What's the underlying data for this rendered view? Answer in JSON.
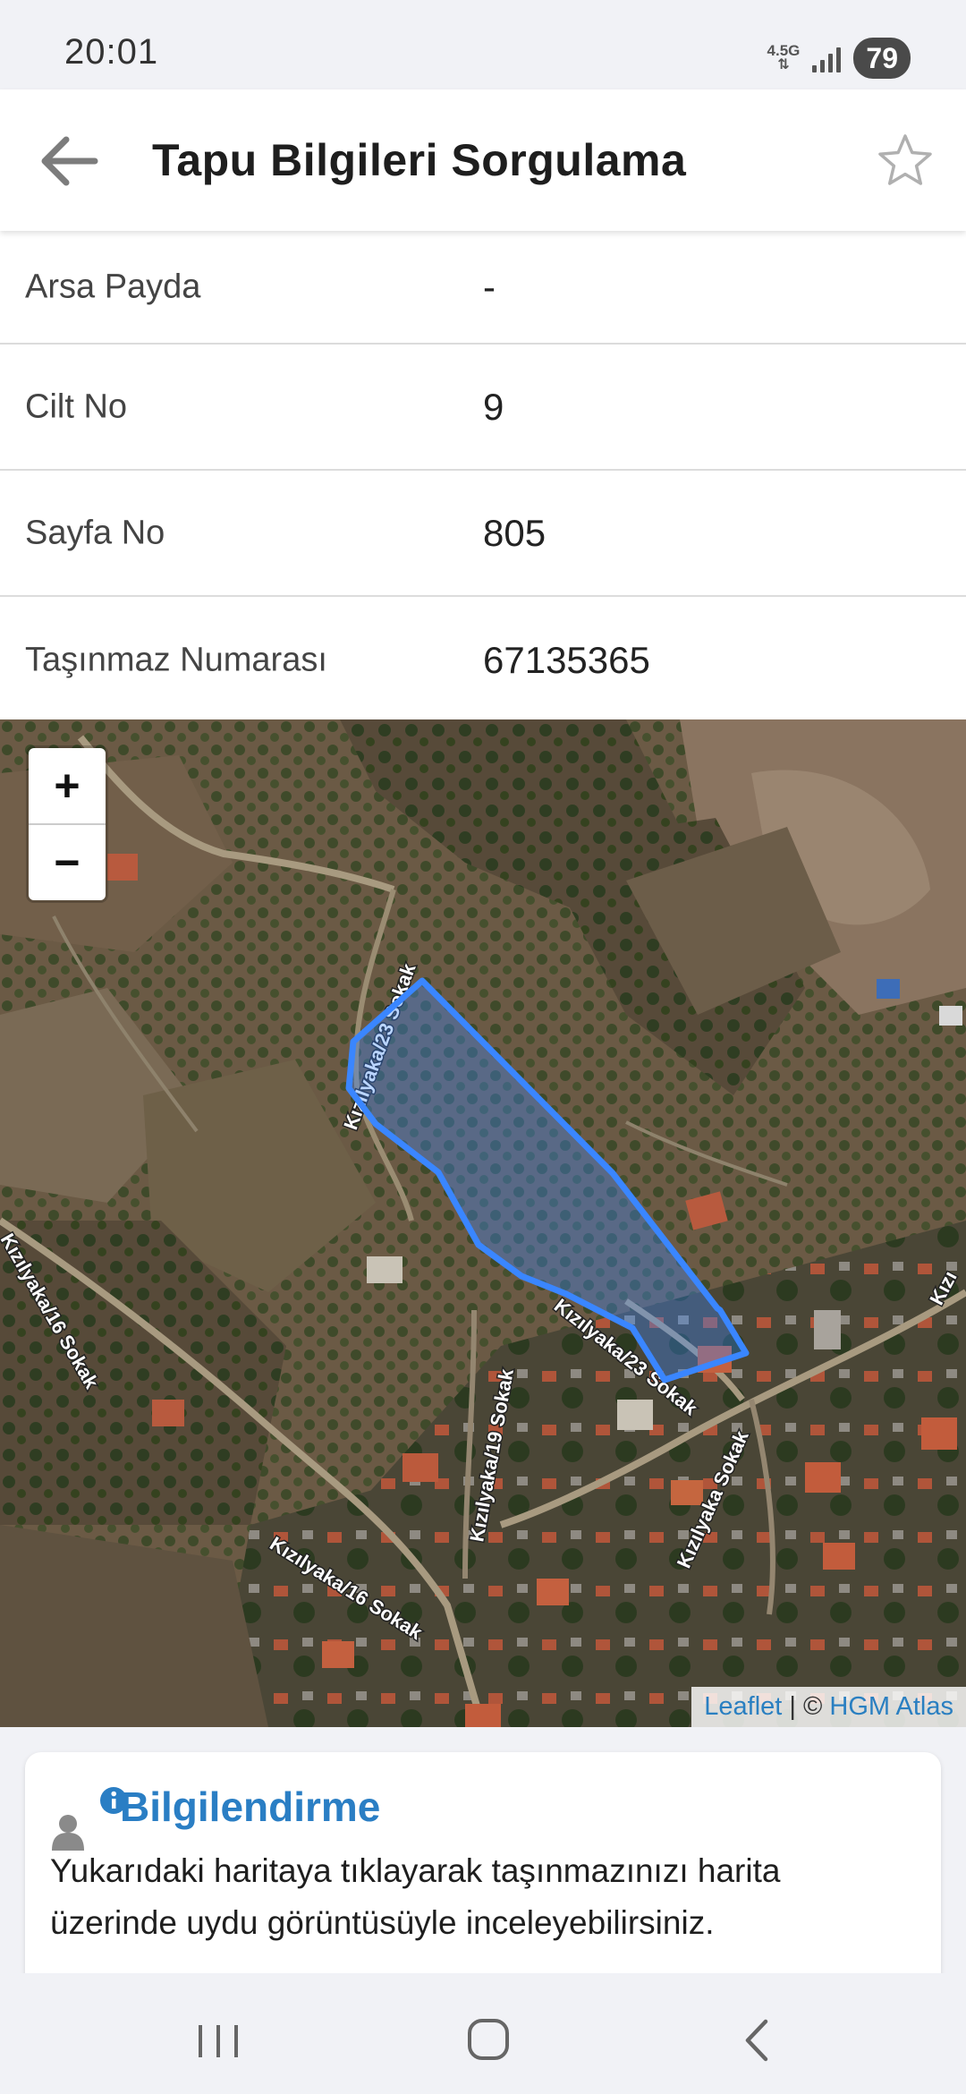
{
  "status_bar": {
    "time": "20:01",
    "network": "4.5G",
    "battery": "79"
  },
  "header": {
    "title": "Tapu Bilgileri Sorgulama",
    "back_icon": "arrow-left-icon",
    "favorite_icon": "star-outline-icon"
  },
  "fields": [
    {
      "label": "Arsa Payda",
      "value": "-"
    },
    {
      "label": "Cilt No",
      "value": "9"
    },
    {
      "label": "Sayfa No",
      "value": "805"
    },
    {
      "label": "Taşınmaz Numarası",
      "value": "67135365"
    }
  ],
  "map": {
    "zoom_in": "+",
    "zoom_out": "−",
    "attribution_leaflet": "Leaflet",
    "attribution_sep": " | © ",
    "attribution_source": "HGM Atlas",
    "street_labels": [
      "Kızılyaka/23 Sokak",
      "Kızılyaka/23 Sokak",
      "Kızılyaka/19 Sokak",
      "Kızılyaka Sokak",
      "Kızılyaka/16 Sokak",
      "Kızılyaka/16 Sokak",
      "Kızı"
    ],
    "parcel_color": "#3a86ff"
  },
  "info_card": {
    "title": "Bilgilendirme",
    "text": "Yukarıdaki haritaya tıklayarak taşınmazınızı harita üzerinde uydu görüntüsüyle inceleyebilirsiniz.",
    "icon": "user-info-icon"
  },
  "navbar": {
    "recents_icon": "recents-icon",
    "home_icon": "home-icon",
    "back_icon": "nav-back-icon"
  }
}
